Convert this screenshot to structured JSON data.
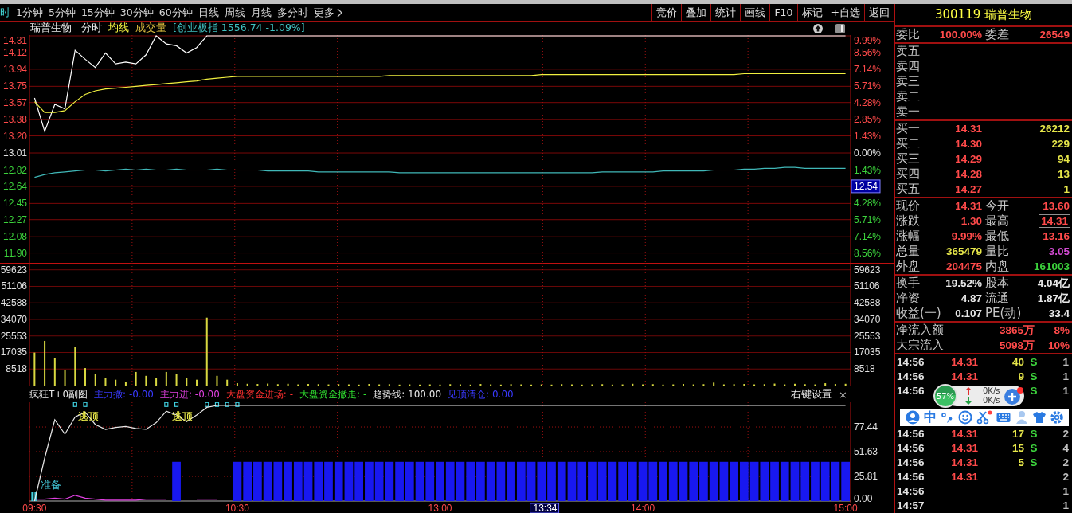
{
  "toolbar": {
    "periods": [
      {
        "label": "时",
        "selected": true
      },
      {
        "label": "1分钟",
        "selected": false
      },
      {
        "label": "5分钟",
        "selected": false
      },
      {
        "label": "15分钟",
        "selected": false
      },
      {
        "label": "30分钟",
        "selected": false
      },
      {
        "label": "60分钟",
        "selected": false
      },
      {
        "label": "日线",
        "selected": false
      },
      {
        "label": "周线",
        "selected": false
      },
      {
        "label": "月线",
        "selected": false
      },
      {
        "label": "多分时",
        "selected": false
      },
      {
        "label": "更多",
        "selected": false
      }
    ],
    "actions": [
      "竞价",
      "叠加",
      "统计",
      "画线",
      "F10",
      "标记",
      "+自选",
      "返回"
    ]
  },
  "chart_header": {
    "stock": "瑞普生物",
    "items": [
      {
        "label": "分时",
        "kind": "mode"
      },
      {
        "label": "均线",
        "kind": "avg"
      },
      {
        "label": "成交量",
        "kind": "volume"
      },
      {
        "label": "[创业板指 1556.74 -1.09%]",
        "kind": "index"
      }
    ]
  },
  "price_chart": {
    "chart_data": {
      "type": "line",
      "grid": true,
      "ylim": [
        11.9,
        14.31
      ],
      "categories": [
        null,
        null,
        null,
        null,
        null,
        null,
        null,
        null,
        null,
        null,
        null,
        null,
        null,
        null,
        null,
        null,
        null,
        null,
        null,
        null,
        null,
        null,
        null,
        null,
        null,
        null,
        null,
        null,
        null,
        null,
        null,
        null,
        null,
        null,
        null,
        null,
        null,
        null,
        null,
        null,
        null,
        null,
        null,
        null,
        null,
        null,
        null,
        null,
        null,
        null,
        null,
        null,
        null,
        null,
        null,
        null,
        null,
        null,
        null,
        null,
        null,
        null,
        null,
        null,
        null,
        null,
        null,
        null,
        null,
        null,
        null,
        null,
        null,
        null,
        null,
        null,
        null,
        null,
        null,
        null,
        null
      ],
      "yticks": [
        {
          "value": 14.31,
          "label": "14.31"
        },
        {
          "value": 14.12,
          "label": "14.12"
        },
        {
          "value": 13.94,
          "label": "13.94"
        },
        {
          "value": 13.75,
          "label": "13.75"
        },
        {
          "value": 13.57,
          "label": "13.57"
        },
        {
          "value": 13.38,
          "label": "13.38"
        },
        {
          "value": 13.2,
          "label": "13.20"
        },
        {
          "value": 13.01,
          "label": "13.01"
        },
        {
          "value": 12.82,
          "label": "12.82"
        },
        {
          "value": 12.64,
          "label": "12.64"
        },
        {
          "value": 12.45,
          "label": "12.45"
        },
        {
          "value": 12.27,
          "label": "12.27"
        },
        {
          "value": 12.08,
          "label": "12.08"
        },
        {
          "value": 11.9,
          "label": "11.90"
        }
      ],
      "series": [
        {
          "color": "#ffffff",
          "values": [
            13.62,
            13.25,
            13.55,
            13.5,
            14.15,
            14.05,
            13.96,
            14.12,
            14.0,
            14.02,
            14.0,
            14.1,
            14.31,
            14.22,
            14.2,
            14.12,
            14.18,
            14.31,
            14.31,
            14.31,
            14.31,
            14.31,
            14.31,
            14.31,
            14.31,
            14.31,
            14.31,
            14.31,
            14.31,
            14.31,
            14.31,
            14.31,
            14.31,
            14.31,
            14.31,
            14.31,
            14.31,
            14.31,
            14.31,
            14.31,
            14.31,
            14.31,
            14.31,
            14.31,
            14.31,
            14.31,
            14.31,
            14.31,
            14.31,
            14.31,
            14.31,
            14.31,
            14.31,
            14.31,
            14.31,
            14.31,
            14.31,
            14.31,
            14.31,
            14.31,
            14.31,
            14.31,
            14.31,
            14.31,
            14.31,
            14.31,
            14.31,
            14.31,
            14.31,
            14.31,
            14.31,
            14.31,
            14.31,
            14.31,
            14.31,
            14.31,
            14.31,
            14.31,
            14.31,
            14.31,
            14.31
          ]
        },
        {
          "color": "#f0f040",
          "values": [
            13.58,
            13.46,
            13.46,
            13.48,
            13.58,
            13.66,
            13.7,
            13.72,
            13.73,
            13.74,
            13.75,
            13.76,
            13.77,
            13.78,
            13.79,
            13.8,
            13.81,
            13.83,
            13.84,
            13.85,
            13.86,
            13.86,
            13.86,
            13.86,
            13.86,
            13.86,
            13.86,
            13.86,
            13.86,
            13.86,
            13.86,
            13.86,
            13.86,
            13.86,
            13.86,
            13.87,
            13.87,
            13.87,
            13.87,
            13.87,
            13.87,
            13.87,
            13.87,
            13.87,
            13.87,
            13.87,
            13.87,
            13.87,
            13.87,
            13.87,
            13.88,
            13.88,
            13.88,
            13.88,
            13.88,
            13.88,
            13.88,
            13.88,
            13.88,
            13.88,
            13.88,
            13.88,
            13.88,
            13.88,
            13.88,
            13.88,
            13.88,
            13.88,
            13.88,
            13.88,
            13.89,
            13.89,
            13.89,
            13.89,
            13.89,
            13.89,
            13.89,
            13.89,
            13.89,
            13.89,
            13.89
          ]
        },
        {
          "color": "#40b8b8",
          "values": [
            12.74,
            12.77,
            12.79,
            12.8,
            12.81,
            12.82,
            12.82,
            12.81,
            12.82,
            12.83,
            12.82,
            12.83,
            12.82,
            12.82,
            12.83,
            12.82,
            12.82,
            12.82,
            12.83,
            12.82,
            12.82,
            12.82,
            12.82,
            12.81,
            12.81,
            12.81,
            12.81,
            12.81,
            12.8,
            12.8,
            12.8,
            12.8,
            12.8,
            12.8,
            12.8,
            12.8,
            12.79,
            12.79,
            12.79,
            12.79,
            12.79,
            12.79,
            12.79,
            12.79,
            12.79,
            12.79,
            12.79,
            12.79,
            12.79,
            12.79,
            12.79,
            12.79,
            12.79,
            12.79,
            12.79,
            12.79,
            12.8,
            12.8,
            12.8,
            12.8,
            12.8,
            12.8,
            12.81,
            12.81,
            12.81,
            12.81,
            12.81,
            12.82,
            12.82,
            12.82,
            12.83,
            12.83,
            12.84,
            12.84,
            12.85,
            12.85,
            12.84,
            12.84,
            12.84,
            12.84,
            12.84
          ]
        }
      ]
    },
    "right_labels": [
      {
        "label": "9.99%",
        "cursor": false
      },
      {
        "label": "8.56%",
        "cursor": false
      },
      {
        "label": "7.14%",
        "cursor": false
      },
      {
        "label": "5.71%",
        "cursor": false
      },
      {
        "label": "4.28%",
        "cursor": false
      },
      {
        "label": "2.85%",
        "cursor": false
      },
      {
        "label": "1.43%",
        "cursor": false
      },
      {
        "label": "0.00%",
        "cursor": false
      },
      {
        "label": "1.43%",
        "cursor": false
      },
      {
        "label": "12.54",
        "cursor": true
      },
      {
        "label": "4.28%",
        "cursor": false
      },
      {
        "label": "5.71%",
        "cursor": false
      },
      {
        "label": "7.14%",
        "cursor": false
      },
      {
        "label": "8.56%",
        "cursor": false
      }
    ]
  },
  "volume_chart": {
    "chart_data": {
      "type": "bar",
      "grid": true,
      "ylim": [
        0,
        63200
      ],
      "categories": [
        null,
        null,
        null,
        null,
        null,
        null,
        null,
        null,
        null,
        null,
        null,
        null,
        null,
        null,
        null,
        null,
        null,
        null,
        null,
        null,
        null,
        null,
        null,
        null,
        null,
        null,
        null,
        null,
        null,
        null,
        null,
        null,
        null,
        null,
        null,
        null,
        null,
        null,
        null,
        null,
        null,
        null,
        null,
        null,
        null,
        null,
        null,
        null,
        null,
        null,
        null,
        null,
        null,
        null,
        null,
        null,
        null,
        null,
        null,
        null,
        null,
        null,
        null,
        null,
        null,
        null,
        null,
        null,
        null,
        null,
        null,
        null,
        null,
        null,
        null,
        null,
        null,
        null,
        null,
        null,
        null
      ],
      "values": [
        17000,
        23000,
        14000,
        8000,
        20000,
        9000,
        6000,
        4000,
        3000,
        2000,
        7000,
        5000,
        4000,
        7000,
        6000,
        4000,
        3000,
        35000,
        5000,
        3000,
        1200,
        900,
        800,
        1000,
        700,
        900,
        600,
        800,
        700,
        600,
        700,
        600,
        500,
        800,
        600,
        700,
        500,
        600,
        500,
        600,
        500,
        700,
        600,
        500,
        800,
        600,
        500,
        700,
        600,
        500,
        600,
        500,
        700,
        600,
        500,
        600,
        700,
        500,
        600,
        900,
        600,
        700,
        500,
        600,
        800,
        600,
        700,
        1500,
        600,
        700,
        800,
        600,
        700,
        1000,
        600,
        900,
        700,
        600,
        1200,
        800,
        900
      ],
      "yticks": [
        {
          "value": 59623,
          "label": "59623"
        },
        {
          "value": 51106,
          "label": "51106"
        },
        {
          "value": 42588,
          "label": "42588"
        },
        {
          "value": 34070,
          "label": "34070"
        },
        {
          "value": 25553,
          "label": "25553"
        },
        {
          "value": 17035,
          "label": "17035"
        },
        {
          "value": 8518,
          "label": "8518"
        }
      ]
    },
    "right_labels": [
      "59623",
      "51106",
      "42588",
      "34070",
      "25553",
      "17035",
      "8518"
    ]
  },
  "indicator": {
    "legend": [
      {
        "label": "疯狂T+0副图",
        "kind": "title"
      },
      {
        "label": "主力撤: -0.00",
        "kind": "sell"
      },
      {
        "label": "主力进: -0.00",
        "kind": "buy"
      },
      {
        "label": "大盘资金进场: -",
        "kind": "market_in"
      },
      {
        "label": "大盘资金撤走: -",
        "kind": "market_out"
      },
      {
        "label": "趋势线: 100.00",
        "kind": "trend"
      },
      {
        "label": "见顶清仓: 0.00",
        "kind": "top"
      }
    ],
    "settings": "右键设置",
    "close": "×",
    "cursor_time": "13:34",
    "chart_data": {
      "type": "line",
      "grid": true,
      "ylim": [
        0,
        103.3
      ],
      "categories": [
        "09:30",
        null,
        null,
        null,
        null,
        null,
        null,
        null,
        null,
        null,
        null,
        null,
        null,
        null,
        null,
        null,
        null,
        null,
        null,
        null,
        "10:30",
        null,
        null,
        null,
        null,
        null,
        null,
        null,
        null,
        null,
        null,
        null,
        null,
        null,
        null,
        null,
        null,
        null,
        null,
        null,
        "13:00",
        null,
        null,
        null,
        null,
        null,
        null,
        null,
        null,
        null,
        null,
        null,
        null,
        null,
        null,
        null,
        null,
        null,
        null,
        null,
        "14:00",
        null,
        null,
        null,
        null,
        null,
        null,
        null,
        null,
        null,
        null,
        null,
        null,
        null,
        null,
        null,
        null,
        null,
        null,
        null,
        "15:00"
      ],
      "yticks": [
        {
          "value": 77.44,
          "label": "77.44"
        },
        {
          "value": 51.63,
          "label": "51.63"
        },
        {
          "value": 25.81,
          "label": "25.81"
        },
        {
          "value": 0,
          "label": "0.00"
        }
      ],
      "series": [
        {
          "type": "bar",
          "color": "#1818f0",
          "values": [
            0,
            0,
            0,
            0,
            0,
            0,
            0,
            0,
            0,
            0,
            0,
            0,
            0,
            0,
            41,
            0,
            0,
            0,
            0,
            0,
            41,
            41,
            41,
            41,
            41,
            41,
            41,
            41,
            41,
            41,
            41,
            41,
            41,
            41,
            41,
            41,
            41,
            41,
            41,
            41,
            41,
            41,
            41,
            41,
            41,
            41,
            41,
            41,
            41,
            41,
            41,
            41,
            41,
            41,
            41,
            41,
            41,
            41,
            41,
            41,
            41,
            41,
            41,
            41,
            41,
            41,
            41,
            41,
            41,
            41,
            41,
            41,
            41,
            41,
            41,
            41,
            41,
            41,
            41,
            41,
            41
          ]
        },
        {
          "type": "scatter",
          "color": "#40d0e0",
          "values": [
            null,
            null,
            null,
            null,
            101,
            101,
            null,
            null,
            null,
            null,
            null,
            null,
            null,
            101,
            101,
            null,
            null,
            101,
            101,
            101,
            101,
            null,
            null,
            null,
            null,
            null,
            null,
            null,
            null,
            null,
            null,
            null,
            null,
            null,
            null,
            null,
            null,
            null,
            null,
            null,
            null,
            null,
            null,
            null,
            null,
            null,
            null,
            null,
            null,
            null,
            null,
            null,
            null,
            null,
            null,
            null,
            null,
            null,
            null,
            null,
            null,
            null,
            null,
            null,
            null,
            null,
            null,
            null,
            null,
            null,
            null,
            null,
            null,
            null,
            null,
            null,
            null,
            null,
            null,
            null,
            null
          ]
        },
        {
          "type": "line",
          "color": "#e040e0",
          "values": [
            2,
            2,
            3,
            2,
            6,
            3,
            2,
            1,
            1,
            1,
            1,
            2,
            2,
            2,
            null,
            null,
            2,
            2,
            2,
            null,
            null,
            null,
            null,
            null,
            null,
            null,
            null,
            null,
            null,
            null,
            null,
            null,
            null,
            null,
            null,
            null,
            null,
            null,
            null,
            null,
            null,
            null,
            null,
            null,
            null,
            null,
            null,
            null,
            null,
            null,
            null,
            null,
            null,
            null,
            null,
            null,
            null,
            null,
            null,
            null,
            null,
            null,
            null,
            null,
            null,
            null,
            null,
            null,
            null,
            null,
            null,
            null,
            null,
            null,
            null,
            null,
            null,
            null,
            null,
            null,
            null
          ]
        },
        {
          "type": "line",
          "color": "#e8e8e8",
          "values": [
            0,
            45,
            85,
            70,
            88,
            93,
            80,
            75,
            77,
            78,
            76,
            75,
            82,
            94,
            90,
            83,
            90,
            98,
            100,
            100,
            100,
            100,
            100,
            100,
            100,
            100,
            100,
            100,
            100,
            100,
            100,
            100,
            100,
            100,
            100,
            100,
            100,
            100,
            100,
            100,
            100,
            100,
            100,
            100,
            100,
            100,
            100,
            100,
            100,
            100,
            100,
            100,
            100,
            100,
            100,
            100,
            100,
            100,
            100,
            100,
            100,
            100,
            100,
            100,
            100,
            100,
            100,
            100,
            100,
            100,
            100,
            100,
            100,
            100,
            100,
            100,
            100,
            100,
            100,
            100,
            100
          ]
        }
      ],
      "annotations": [
        "逃顶",
        "逃顶",
        "准备"
      ]
    }
  },
  "quote_panel": {
    "code": "300119",
    "name": "瑞普生物",
    "order_ratio": [
      {
        "label": "委比",
        "value": "100.00%",
        "kind": "rise"
      },
      {
        "label": "委差",
        "value": "26549",
        "kind": "rise"
      }
    ],
    "sell_levels": [
      {
        "label": "卖五"
      },
      {
        "label": "卖四"
      },
      {
        "label": "卖三"
      },
      {
        "label": "卖二"
      },
      {
        "label": "卖一"
      }
    ],
    "buy_levels": [
      {
        "label": "买一",
        "price": "14.31",
        "volume": "26212"
      },
      {
        "label": "买二",
        "price": "14.30",
        "volume": "229"
      },
      {
        "label": "买三",
        "price": "14.29",
        "volume": "94"
      },
      {
        "label": "买四",
        "price": "14.28",
        "volume": "13"
      },
      {
        "label": "买五",
        "price": "14.27",
        "volume": "1"
      }
    ],
    "quote": [
      [
        {
          "label": "现价",
          "value": "14.31",
          "kind": "rise",
          "highlighted": false
        },
        {
          "label": "今开",
          "value": "13.60",
          "kind": "rise",
          "highlighted": false
        }
      ],
      [
        {
          "label": "涨跌",
          "value": "1.30",
          "kind": "rise",
          "highlighted": false
        },
        {
          "label": "最高",
          "value": "14.31",
          "kind": "rise",
          "highlighted": true
        }
      ],
      [
        {
          "label": "涨幅",
          "value": "9.99%",
          "kind": "rise",
          "highlighted": false
        },
        {
          "label": "最低",
          "value": "13.16",
          "kind": "rise",
          "highlighted": false
        }
      ],
      [
        {
          "label": "总量",
          "value": "365479",
          "kind": "volume",
          "highlighted": false
        },
        {
          "label": "量比",
          "value": "3.05",
          "kind": "ratio",
          "highlighted": false
        }
      ],
      [
        {
          "label": "外盘",
          "value": "204475",
          "kind": "rise",
          "highlighted": false
        },
        {
          "label": "内盘",
          "value": "161003",
          "kind": "fall",
          "highlighted": false
        }
      ]
    ],
    "fundamentals": [
      [
        {
          "label": "换手",
          "value": "19.52%"
        },
        {
          "label": "股本",
          "value": "4.04亿"
        }
      ],
      [
        {
          "label": "净资",
          "value": "4.87"
        },
        {
          "label": "流通",
          "value": "1.87亿"
        }
      ],
      [
        {
          "label": "收益(一)",
          "value": "0.107"
        },
        {
          "label": "PE(动)",
          "value": "33.4"
        }
      ]
    ],
    "flows": [
      {
        "label": "净流入额",
        "amount": "3865万",
        "share": "8%"
      },
      {
        "label": "大宗流入",
        "amount": "5098万",
        "share": "10%"
      }
    ],
    "trades_top": [
      {
        "time": "14:56",
        "price": "14.31",
        "volume": "40",
        "side": "S",
        "count": "1"
      },
      {
        "time": "14:56",
        "price": "14.31",
        "volume": "9",
        "side": "S",
        "count": "1"
      },
      {
        "time": "14:56",
        "side": "S",
        "count": "1"
      }
    ],
    "trades_bottom": [
      {
        "time": "14:56",
        "price": "14.31",
        "volume": "17",
        "side": "S",
        "count": "2"
      },
      {
        "time": "14:56",
        "price": "14.31",
        "volume": "15",
        "side": "S",
        "count": "4"
      },
      {
        "time": "14:56",
        "price": "14.31",
        "volume": "5",
        "side": "S",
        "count": "2"
      },
      {
        "time": "14:56",
        "price": "14.31",
        "count": "2"
      },
      {
        "time": "14:56",
        "count": "1"
      },
      {
        "time": "14:57",
        "count": "1"
      }
    ]
  },
  "overlays": {
    "ball": {
      "percent": "57%",
      "up": "0K/s",
      "down": "0K/s"
    },
    "ime": {
      "mode": "中"
    }
  }
}
